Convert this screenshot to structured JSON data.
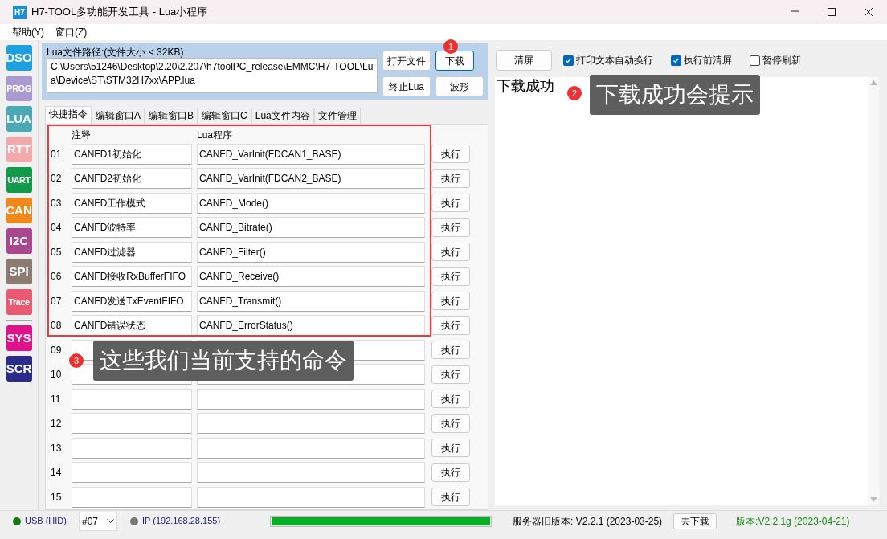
{
  "window": {
    "title": "H7-TOOL多功能开发工具 - Lua小程序",
    "app_icon": "H7"
  },
  "menu": [
    "帮助(Y)",
    "窗口(Z)"
  ],
  "sidebar": [
    {
      "label": "DSO",
      "color": "#1e9fe0"
    },
    {
      "label": "PROG",
      "color": "#a99bd0"
    },
    {
      "label": "LUA",
      "color": "#4aa9b5"
    },
    {
      "label": "RTT",
      "color": "#f3a9ab"
    },
    {
      "label": "UART",
      "color": "#139a4b"
    },
    {
      "label": "CAN",
      "color": "#f0891c"
    },
    {
      "label": "I2C",
      "color": "#a9488f"
    },
    {
      "label": "SPI",
      "color": "#8b7b72"
    },
    {
      "label": "Trace",
      "color": "#e85b70"
    },
    {
      "label": "SYS",
      "color": "#e0118b"
    },
    {
      "label": "SCR",
      "color": "#2b2b8c"
    }
  ],
  "file_panel": {
    "label": "Lua文件路径:(文件大小 < 32KB)",
    "path": "C:\\Users\\51246\\Desktop\\2.20\\2.207\\h7toolPC_release\\EMMC\\H7-TOOL\\Lua\\Device\\ST\\STM32H7xx\\APP.lua",
    "buttons": [
      "打开文件",
      "下载",
      "终止Lua",
      "波形"
    ]
  },
  "tabs": [
    {
      "label": "快捷指令",
      "selected": true
    },
    {
      "label": "编辑窗口A",
      "selected": false
    },
    {
      "label": "编辑窗口B",
      "selected": false
    },
    {
      "label": "编辑窗口C",
      "selected": false
    },
    {
      "label": "Lua文件内容",
      "selected": false
    },
    {
      "label": "文件管理",
      "selected": false
    }
  ],
  "commands": {
    "columns": [
      "注释",
      "Lua程序"
    ],
    "rows": [
      {
        "number": "01",
        "comment": "CANFD1初始化",
        "program": "CANFD_VarInit(FDCAN1_BASE)",
        "button": "执行"
      },
      {
        "number": "02",
        "comment": "CANFD2初始化",
        "program": "CANFD_VarInit(FDCAN2_BASE)",
        "button": "执行"
      },
      {
        "number": "03",
        "comment": "CANFD工作模式",
        "program": "CANFD_Mode()",
        "button": "执行"
      },
      {
        "number": "04",
        "comment": "CANFD波特率",
        "program": "CANFD_Bitrate()",
        "button": "执行"
      },
      {
        "number": "05",
        "comment": "CANFD过滤器",
        "program": "CANFD_Filter()",
        "button": "执行"
      },
      {
        "number": "06",
        "comment": "CANFD接收RxBufferFIFO",
        "program": "CANFD_Receive()",
        "button": "执行"
      },
      {
        "number": "07",
        "comment": "CANFD发送TxEventFIFO",
        "program": "CANFD_Transmit()",
        "button": "执行"
      },
      {
        "number": "08",
        "comment": "CANFD错误状态",
        "program": "CANFD_ErrorStatus()",
        "button": "执行"
      },
      {
        "number": "09",
        "button": "执行"
      },
      {
        "number": "10",
        "button": "执行"
      },
      {
        "number": "11",
        "button": "执行"
      },
      {
        "number": "12",
        "button": "执行"
      },
      {
        "number": "13",
        "button": "执行"
      },
      {
        "number": "14",
        "button": "执行"
      },
      {
        "number": "15",
        "button": "执行"
      }
    ]
  },
  "output": {
    "clear_button": "清屏",
    "options": [
      {
        "label": "打印文本自动换行",
        "checked": true
      },
      {
        "label": "执行前清屏",
        "checked": true
      },
      {
        "label": "暂停刷新",
        "checked": false
      }
    ],
    "text": "下载成功"
  },
  "annotations": [
    {
      "number": "1"
    },
    {
      "number": "2",
      "text": "下载成功会提示"
    },
    {
      "number": "3",
      "text": "这些我们当前支持的命令"
    }
  ],
  "status_bar": {
    "usb": "USB (HID)",
    "port": "#07",
    "ip": "IP (192.168.28.155)",
    "progress": {
      "level": 1
    },
    "server_version": "服务器旧版本: V2.2.1 (2023-03-25)",
    "download_button": "去下载",
    "version": "版本:V2.2.1g (2023-04-21)"
  }
}
